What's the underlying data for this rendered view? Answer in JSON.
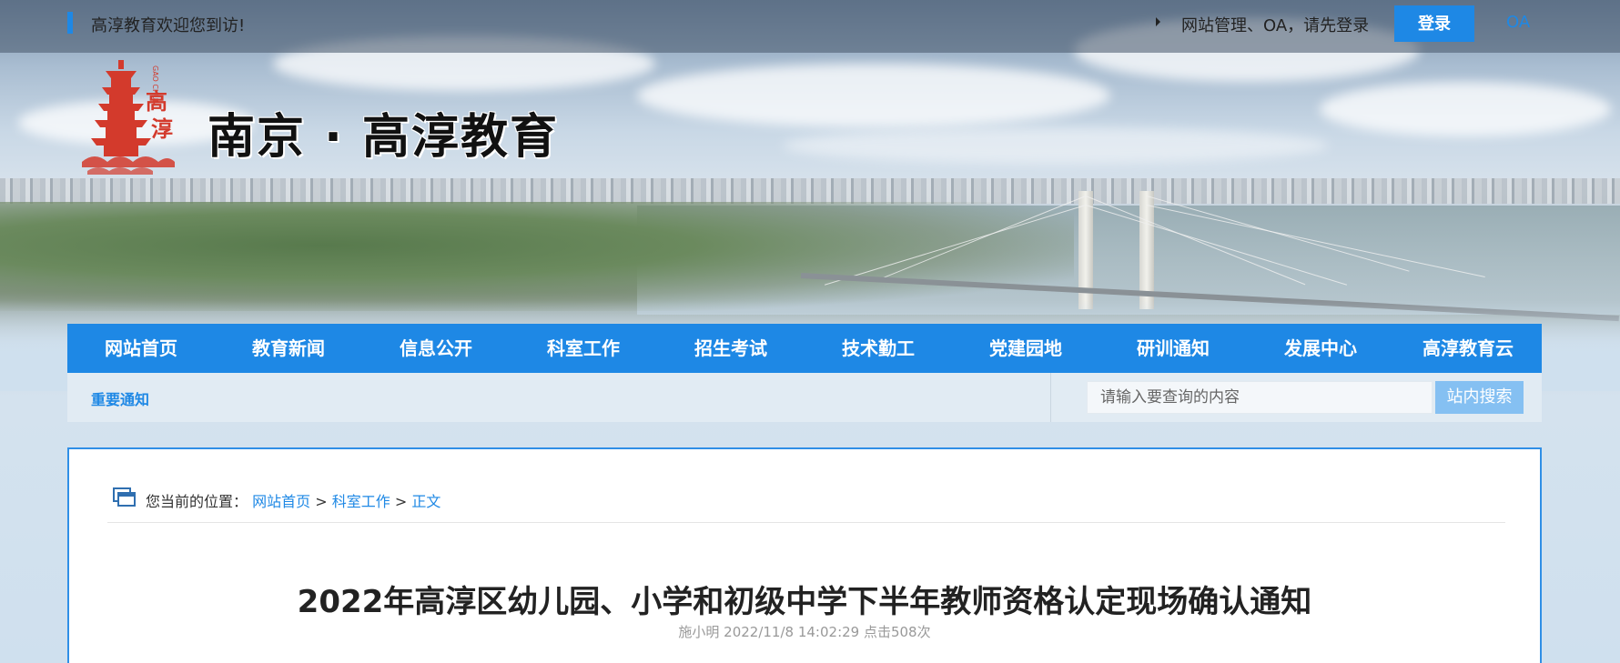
{
  "topbar": {
    "welcome": "高淳教育欢迎您到访!",
    "management": "网站管理、OA，请先登录",
    "login_label": "登录",
    "oa_label": "OA"
  },
  "header": {
    "site_title": "南京 · 高淳教育",
    "logo_vertical_text": "GAO CHUN",
    "logo_chars": "高淳"
  },
  "nav": {
    "items": [
      "网站首页",
      "教育新闻",
      "信息公开",
      "科室工作",
      "招生考试",
      "技术勤工",
      "党建园地",
      "研训通知",
      "发展中心",
      "高淳教育云"
    ]
  },
  "subbar": {
    "notice_label": "重要通知",
    "search_placeholder": "请输入要查询的内容",
    "search_button": "站内搜索"
  },
  "breadcrumb": {
    "prefix": "您当前的位置：",
    "items": [
      "网站首页",
      "科室工作",
      "正文"
    ],
    "separator": ">"
  },
  "article": {
    "title": "2022年高淳区幼儿园、小学和初级中学下半年教师资格认定现场确认通知",
    "meta": "施小明 2022/11/8 14:02:29 点击508次"
  },
  "colors": {
    "accent": "#1e88e5",
    "search_button": "#85c0f2",
    "subbar_bg": "#e1ebf3"
  }
}
